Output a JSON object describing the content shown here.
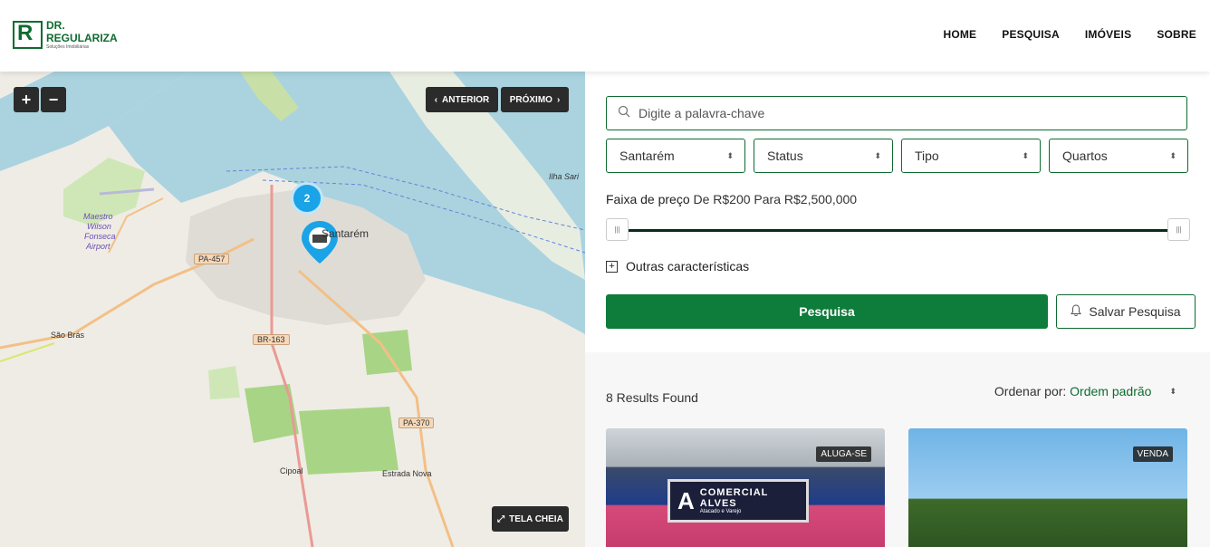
{
  "header": {
    "logo": {
      "letter": "R",
      "line1": "DR.",
      "line2": "REGULARIZA",
      "line3": "Soluções Imobiliárias"
    },
    "nav": [
      "HOME",
      "PESQUISA",
      "IMÓVEIS",
      "SOBRE"
    ]
  },
  "map": {
    "zoom_in": "+",
    "zoom_out": "−",
    "prev_label": "ANTERIOR",
    "next_label": "PRÓXIMO",
    "fullscreen_label": "TELA CHEIA",
    "cluster_count": "2",
    "labels": {
      "santarem": "Santarém",
      "ilha": "Ilha Sari",
      "airport1": "Maestro",
      "airport2": "Wilson",
      "airport3": "Fonseca",
      "airport4": "Airport",
      "sao_bras": "São Brás",
      "cipoal": "Cipoal",
      "estrada_nova": "Estrada Nova"
    },
    "roads": {
      "pa457": "PA-457",
      "br163": "BR-163",
      "pa370": "PA-370"
    }
  },
  "filters": {
    "search_placeholder": "Digite a palavra-chave",
    "city": "Santarém",
    "status": "Status",
    "type": "Tipo",
    "rooms": "Quartos",
    "price_label": "Faixa de preço",
    "price_range": "De R$200 Para R$2,500,000",
    "more_label": "Outras características",
    "search_button": "Pesquisa",
    "save_button": "Salvar Pesquisa"
  },
  "results": {
    "count_text": "8 Results Found",
    "sort_label": "Ordenar por:",
    "sort_value": "Ordem padrão",
    "cards": [
      {
        "badge": "ALUGA-SE",
        "sign_line1": "COMERCIAL",
        "sign_line2": "ALVES",
        "sign_line3": "Atacado e Varejo"
      },
      {
        "badge": "VENDA"
      }
    ]
  },
  "colors": {
    "brand": "#0e7c3a",
    "cluster": "#1aa3e6",
    "water": "#aad3df"
  }
}
